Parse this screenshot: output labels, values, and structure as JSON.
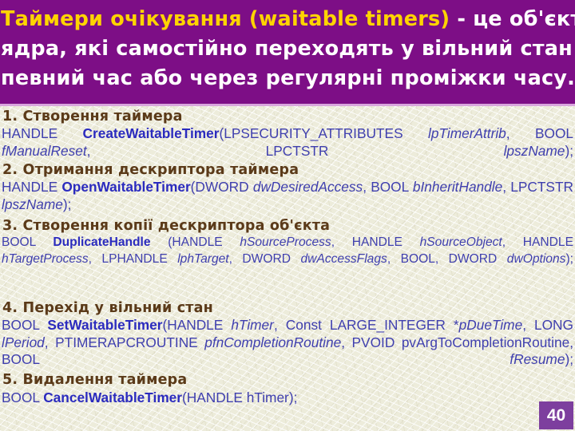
{
  "slide": {
    "page_number": "40",
    "colors": {
      "title_band": "#7d0e86",
      "title_highlight": "#ffd400",
      "title_text": "#ffffff",
      "body_background": "#edecdb",
      "section_heading": "#5b3a19",
      "code_text": "#3f3fae",
      "code_bold": "#2b2bbe",
      "badge": "#7d3f9e"
    }
  },
  "title": {
    "line1_highlight": "Таймери очікування (waitable timers)",
    "line1_rest": " - це об'єкти",
    "line2": "ядра, які самостійно переходять у вільний стан в",
    "line3": "певний час або через регулярні проміжки часу."
  },
  "sections": [
    {
      "heading": "1. Створення таймера",
      "code": {
        "ret": "HANDLE",
        "fn": "CreateWaitableTimer",
        "args_a": "(LPSECURITY_ATTRIBUTES ",
        "arg1": "lpTimerAttrib",
        "mid1": ", BOOL ",
        "arg2": "fManualReset",
        "mid2": ", LPCTSTR ",
        "arg3": "lpszName",
        "tail": ");"
      }
    },
    {
      "heading": "2. Отримання дескриптора таймера",
      "code": {
        "ret": "HANDLE",
        "fn": "OpenWaitableTimer",
        "args_a": "(DWORD ",
        "arg1": "dwDesiredAccess",
        "mid1": ", BOOL ",
        "arg2": "bInheritHandle",
        "mid2": ", LPCTSTR ",
        "arg3": "lpszName",
        "tail": ");"
      }
    },
    {
      "heading": "3. Створення копії дескриптора об'єкта",
      "code": {
        "ret": "BOOL ",
        "fn": "DuplicateHandle",
        "args_a": " (HANDLE ",
        "arg1": "hSourceProcess",
        "mid1": ", HANDLE ",
        "arg2": "hSourceObject",
        "mid2": ", HANDLE ",
        "arg3": "hTargetProcess",
        "mid3": ", LPHANDLE ",
        "arg4": "lphTarget",
        "mid4": ", DWORD ",
        "arg5": "dwAccessFlags",
        "mid5": ", BOOL, DWORD ",
        "arg6": "dwOptions",
        "tail": ");"
      }
    },
    {
      "heading": "4. Перехід у вільний стан",
      "code": {
        "ret": "BOOL",
        "fn": "SetWaitableTimer",
        "args_a": "(HANDLE ",
        "arg1": "hTimer",
        "mid1": ", Const LARGE_INTEGER *",
        "arg2": "pDueTime",
        "mid2": ", LONG ",
        "arg3": "lPeriod",
        "mid3": ", PTIMERAPCROUTINE ",
        "arg4": "pfnCompletionRoutine",
        "mid4": ", PVOID pvArgToCompletionRoutine, BOOL ",
        "arg5": "fResume",
        "tail": ");"
      }
    },
    {
      "heading": "5. Видалення таймера",
      "code": {
        "ret": "BOOL ",
        "fn": "CancelWaitableTimer",
        "args_a": "(HANDLE hTimer);"
      }
    }
  ]
}
